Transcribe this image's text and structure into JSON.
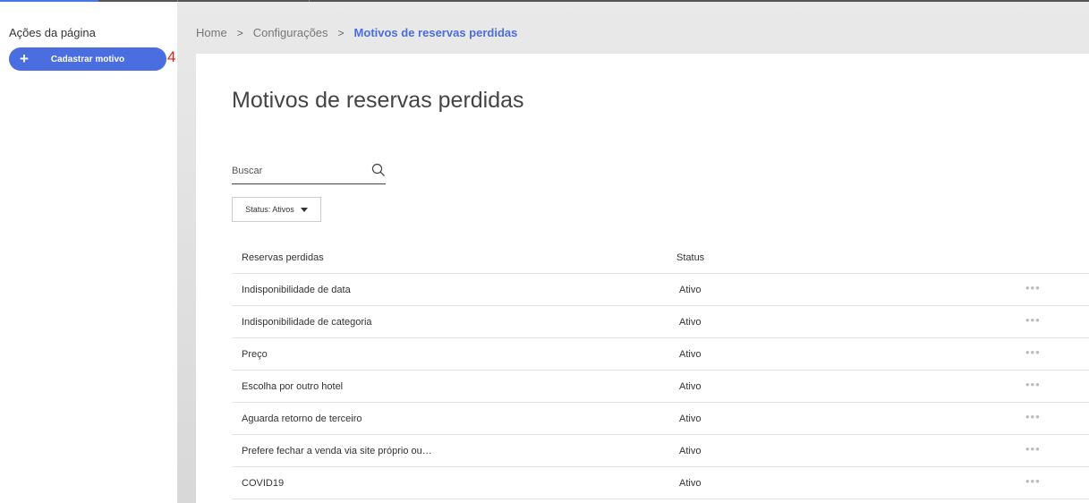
{
  "sidebar": {
    "title": "Ações da página",
    "button_plus": "+",
    "button_label": "Cadastrar motivo",
    "marker": "4"
  },
  "breadcrumb": {
    "items": [
      "Home",
      "Configurações",
      "Motivos de reservas perdidas"
    ],
    "separator": ">"
  },
  "page": {
    "title": "Motivos de reservas perdidas"
  },
  "search": {
    "placeholder": "Buscar",
    "icon": "search-icon"
  },
  "filter": {
    "label": "Status: Ativos"
  },
  "table": {
    "headers": [
      "Reservas perdidas",
      "Status"
    ],
    "action_glyph": "•••",
    "rows": [
      {
        "name": "Indisponibilidade de data",
        "status": "Ativo"
      },
      {
        "name": "Indisponibilidade de categoria",
        "status": "Ativo"
      },
      {
        "name": "Preço",
        "status": "Ativo"
      },
      {
        "name": "Escolha por outro hotel",
        "status": "Ativo"
      },
      {
        "name": "Aguarda retorno de terceiro",
        "status": "Ativo"
      },
      {
        "name": "Prefere fechar a venda via site próprio ou…",
        "status": "Ativo"
      },
      {
        "name": "COVID19",
        "status": "Ativo"
      }
    ]
  },
  "colors": {
    "accent": "#4a6ee0",
    "marker": "#e0201b"
  }
}
